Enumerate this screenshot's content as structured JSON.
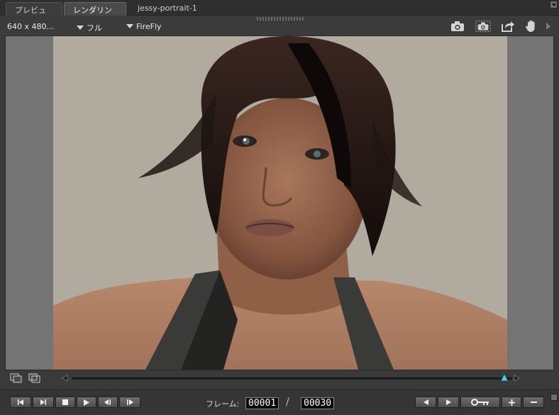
{
  "tabs": [
    {
      "label": "プレビュー",
      "active": false
    },
    {
      "label": "レンダリング",
      "active": true
    },
    {
      "label": "jessy-portrait-1",
      "active": false
    }
  ],
  "options": {
    "resolution": "640 x 480…",
    "mode": "フル",
    "renderer": "FireFly"
  },
  "toolbar_icons": [
    "render-camera-icon",
    "area-render-camera-icon",
    "export-icon",
    "hand-pan-icon",
    "expand-arrow-icon"
  ],
  "timeline": {
    "position": 1.0
  },
  "transport": {
    "frame_label": "フレーム:",
    "current_frame": "00001",
    "slash": "/",
    "total_frames": "00030"
  },
  "colors": {
    "background": "#3a3a3a",
    "render_background": "#b1aa9f",
    "slider_handle": "#5fc8d8"
  }
}
